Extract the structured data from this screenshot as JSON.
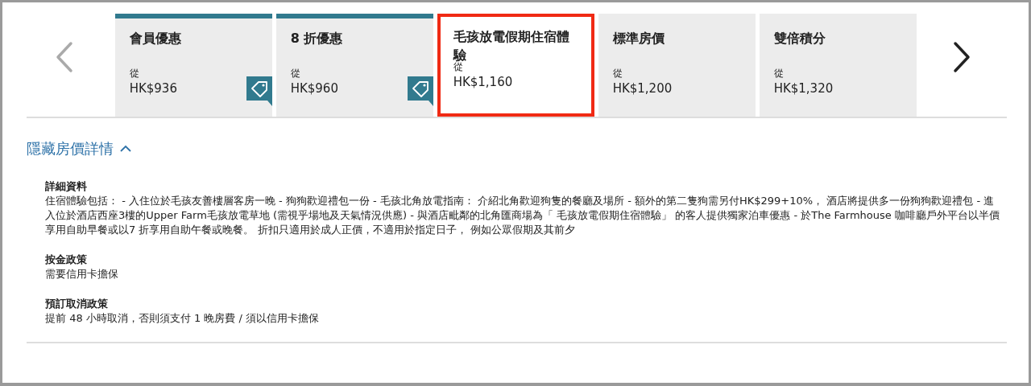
{
  "carousel": {
    "prev_disabled": true,
    "next_disabled": false,
    "rates": [
      {
        "label": "會員優惠",
        "from": "從",
        "price": "HK$936",
        "promo": true,
        "selected": false
      },
      {
        "label": "8 折優惠",
        "from": "從",
        "price": "HK$960",
        "promo": true,
        "selected": false
      },
      {
        "label": "毛孩放電假期住宿體驗",
        "from": "從",
        "price": "HK$1,160",
        "promo": false,
        "selected": true
      },
      {
        "label": "標準房價",
        "from": "從",
        "price": "HK$1,200",
        "promo": false,
        "selected": false
      },
      {
        "label": "雙倍積分",
        "from": "從",
        "price": "HK$1,320",
        "promo": false,
        "selected": false
      }
    ]
  },
  "details_toggle": {
    "label": "隱藏房價詳情",
    "expanded": true
  },
  "sections": [
    {
      "title": "詳細資料",
      "text": "住宿體驗包括： - 入住位於毛孩友善樓層客房一晚 - 狗狗歡迎禮包一份 - 毛孩北角放電指南： 介紹北角歡迎狗隻的餐廳及場所 - 額外的第二隻狗需另付HK$299+10%， 酒店將提供多一份狗狗歡迎禮包 - 進入位於酒店西座3樓的Upper Farm毛孩放電草地 (需視乎場地及天氣情況供應) - 與酒店毗鄰的北角匯商場為「 毛孩放電假期住宿體驗」 的客人提供獨家泊車優惠 - 於The Farmhouse 咖啡廳戶外平台以半價享用自助早餐或以7 折享用自助午餐或晚餐。 折扣只適用於成人正價，不適用於指定日子， 例如公眾假期及其前夕"
    },
    {
      "title": "按金政策",
      "text": "需要信用卡擔保"
    },
    {
      "title": "預訂取消政策",
      "text": "提前 48 小時取消，否則須支付 1 晚房費 / 須以信用卡擔保"
    }
  ]
}
